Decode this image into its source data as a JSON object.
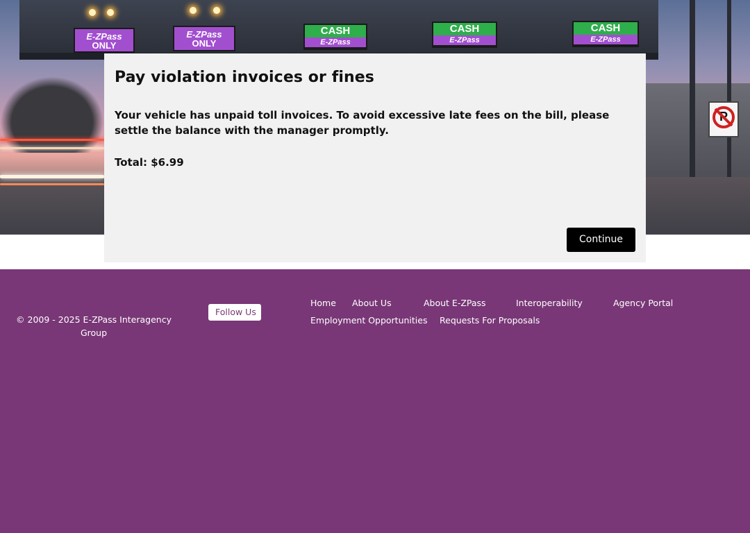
{
  "hero": {
    "signs": [
      {
        "kind": "purple",
        "line1": "E-ZPass",
        "line2": "ONLY"
      },
      {
        "kind": "purple",
        "line1": "E-ZPass",
        "line2": "ONLY"
      },
      {
        "kind": "cash",
        "line1": "CASH",
        "line2": "E-ZPass"
      },
      {
        "kind": "cash",
        "line1": "CASH",
        "line2": "E-ZPass"
      },
      {
        "kind": "cash",
        "line1": "CASH",
        "line2": "E-ZPass"
      }
    ],
    "parking_sign_letter": "P"
  },
  "modal": {
    "title": "Pay violation invoices or fines",
    "message": "Your vehicle has unpaid toll invoices. To avoid excessive late fees on the bill, please settle the balance with the manager promptly.",
    "total": "Total: $6.99",
    "continue_label": "Continue"
  },
  "footer": {
    "copyright": "© 2009 - 2025 E-ZPass Interagency Group",
    "follow_label": "Follow Us",
    "follow_icon": "",
    "separator_icon": "",
    "links_row1": [
      "Home",
      "About Us",
      "About E-ZPass",
      "Interoperability",
      "Agency Portal"
    ],
    "links_row2": [
      "Employment Opportunities",
      "Requests For Proposals"
    ]
  },
  "colors": {
    "footer_bg": "#793777",
    "modal_bg": "#f1f1f1",
    "button_bg": "#000000",
    "sign_purple": "#a24fcf",
    "sign_green": "#2fae4c"
  }
}
